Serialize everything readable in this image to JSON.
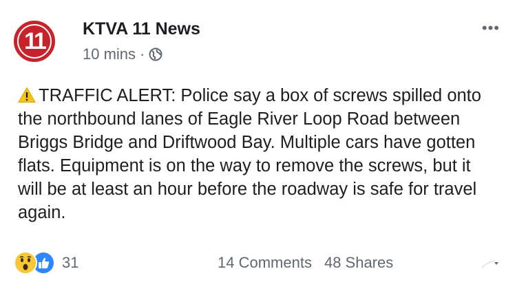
{
  "post": {
    "page_name": "KTVA 11 News",
    "avatar_text": "11",
    "timestamp": "10 mins",
    "separator": "·",
    "privacy_icon": "globe-icon",
    "more_label": "•••",
    "alert_icon": "warning-icon",
    "body": "TRAFFIC ALERT: Police say a box of screws spilled onto the northbound lanes of Eagle River Loop Road between Briggs Bridge and Driftwood Bay. Multiple cars have gotten flats. Equipment is on the way to remove the screws, but it will be at least an hour before the roadway is safe for travel again."
  },
  "footer": {
    "reaction_icons": [
      "wow-icon",
      "like-icon"
    ],
    "reaction_count": "31",
    "comments_label": "14 Comments",
    "shares_label": "48 Shares"
  },
  "colors": {
    "brand_red": "#c8232c",
    "like_blue": "#2d88ff",
    "wow_yellow": "#f7c736",
    "text_primary": "#1c1e21",
    "text_secondary": "#606770"
  }
}
